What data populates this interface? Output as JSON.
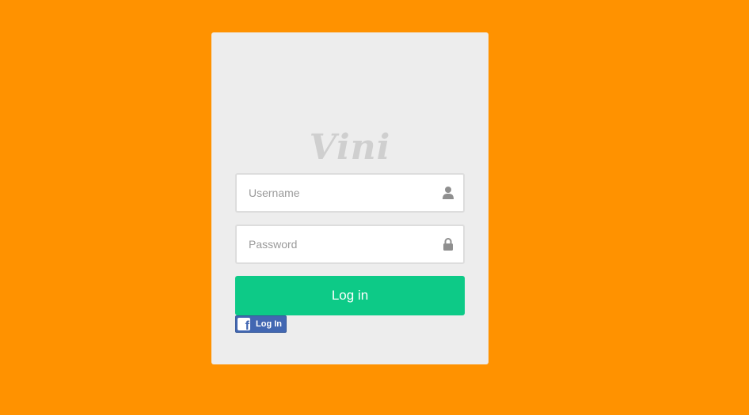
{
  "brand": {
    "logo_text": "Vini"
  },
  "form": {
    "username": {
      "placeholder": "Username",
      "value": "",
      "icon": "user-icon"
    },
    "password": {
      "placeholder": "Password",
      "value": "",
      "icon": "lock-icon"
    },
    "submit_label": "Log in"
  },
  "facebook": {
    "icon_glyph": "f",
    "label": "Log In",
    "icon": "facebook-icon"
  },
  "colors": {
    "background": "#ff9200",
    "card": "#ededed",
    "primary_button": "#0dca87",
    "facebook": "#4267b2"
  }
}
